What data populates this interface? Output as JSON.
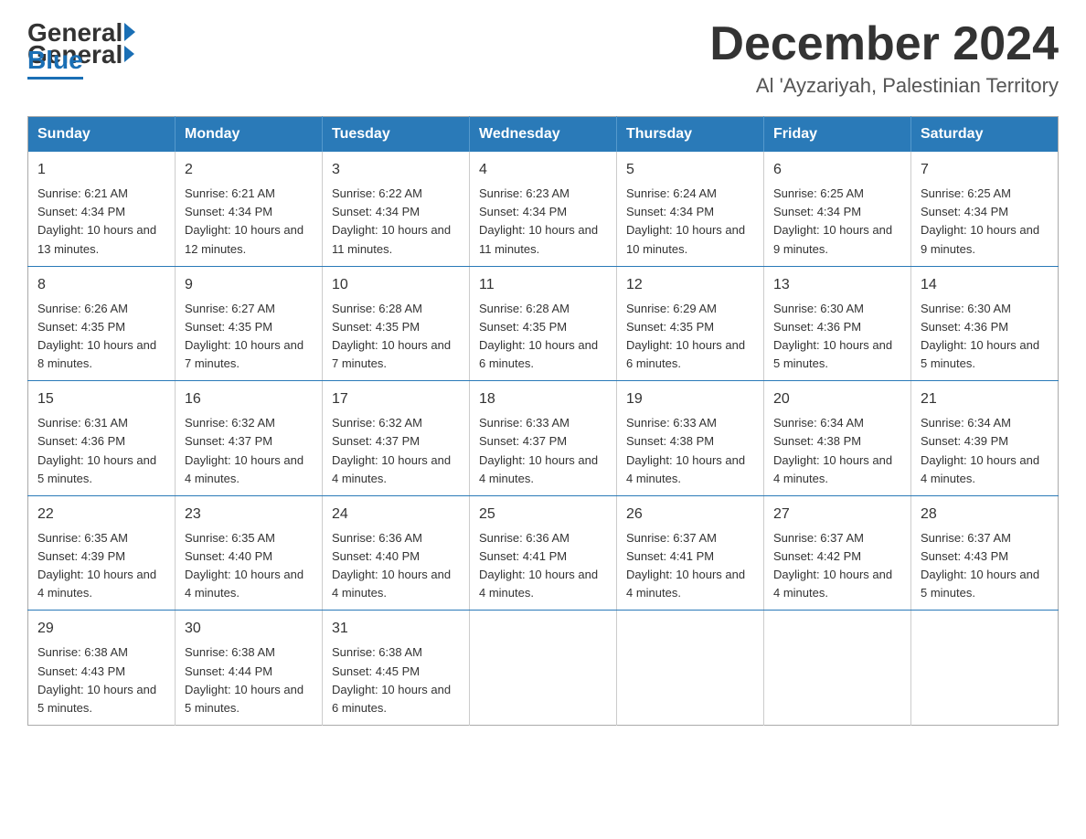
{
  "logo": {
    "general": "General",
    "blue": "Blue"
  },
  "title": "December 2024",
  "subtitle": "Al 'Ayzariyah, Palestinian Territory",
  "days_of_week": [
    "Sunday",
    "Monday",
    "Tuesday",
    "Wednesday",
    "Thursday",
    "Friday",
    "Saturday"
  ],
  "weeks": [
    [
      {
        "day": 1,
        "sunrise": "6:21 AM",
        "sunset": "4:34 PM",
        "daylight": "10 hours and 13 minutes."
      },
      {
        "day": 2,
        "sunrise": "6:21 AM",
        "sunset": "4:34 PM",
        "daylight": "10 hours and 12 minutes."
      },
      {
        "day": 3,
        "sunrise": "6:22 AM",
        "sunset": "4:34 PM",
        "daylight": "10 hours and 11 minutes."
      },
      {
        "day": 4,
        "sunrise": "6:23 AM",
        "sunset": "4:34 PM",
        "daylight": "10 hours and 11 minutes."
      },
      {
        "day": 5,
        "sunrise": "6:24 AM",
        "sunset": "4:34 PM",
        "daylight": "10 hours and 10 minutes."
      },
      {
        "day": 6,
        "sunrise": "6:25 AM",
        "sunset": "4:34 PM",
        "daylight": "10 hours and 9 minutes."
      },
      {
        "day": 7,
        "sunrise": "6:25 AM",
        "sunset": "4:34 PM",
        "daylight": "10 hours and 9 minutes."
      }
    ],
    [
      {
        "day": 8,
        "sunrise": "6:26 AM",
        "sunset": "4:35 PM",
        "daylight": "10 hours and 8 minutes."
      },
      {
        "day": 9,
        "sunrise": "6:27 AM",
        "sunset": "4:35 PM",
        "daylight": "10 hours and 7 minutes."
      },
      {
        "day": 10,
        "sunrise": "6:28 AM",
        "sunset": "4:35 PM",
        "daylight": "10 hours and 7 minutes."
      },
      {
        "day": 11,
        "sunrise": "6:28 AM",
        "sunset": "4:35 PM",
        "daylight": "10 hours and 6 minutes."
      },
      {
        "day": 12,
        "sunrise": "6:29 AM",
        "sunset": "4:35 PM",
        "daylight": "10 hours and 6 minutes."
      },
      {
        "day": 13,
        "sunrise": "6:30 AM",
        "sunset": "4:36 PM",
        "daylight": "10 hours and 5 minutes."
      },
      {
        "day": 14,
        "sunrise": "6:30 AM",
        "sunset": "4:36 PM",
        "daylight": "10 hours and 5 minutes."
      }
    ],
    [
      {
        "day": 15,
        "sunrise": "6:31 AM",
        "sunset": "4:36 PM",
        "daylight": "10 hours and 5 minutes."
      },
      {
        "day": 16,
        "sunrise": "6:32 AM",
        "sunset": "4:37 PM",
        "daylight": "10 hours and 4 minutes."
      },
      {
        "day": 17,
        "sunrise": "6:32 AM",
        "sunset": "4:37 PM",
        "daylight": "10 hours and 4 minutes."
      },
      {
        "day": 18,
        "sunrise": "6:33 AM",
        "sunset": "4:37 PM",
        "daylight": "10 hours and 4 minutes."
      },
      {
        "day": 19,
        "sunrise": "6:33 AM",
        "sunset": "4:38 PM",
        "daylight": "10 hours and 4 minutes."
      },
      {
        "day": 20,
        "sunrise": "6:34 AM",
        "sunset": "4:38 PM",
        "daylight": "10 hours and 4 minutes."
      },
      {
        "day": 21,
        "sunrise": "6:34 AM",
        "sunset": "4:39 PM",
        "daylight": "10 hours and 4 minutes."
      }
    ],
    [
      {
        "day": 22,
        "sunrise": "6:35 AM",
        "sunset": "4:39 PM",
        "daylight": "10 hours and 4 minutes."
      },
      {
        "day": 23,
        "sunrise": "6:35 AM",
        "sunset": "4:40 PM",
        "daylight": "10 hours and 4 minutes."
      },
      {
        "day": 24,
        "sunrise": "6:36 AM",
        "sunset": "4:40 PM",
        "daylight": "10 hours and 4 minutes."
      },
      {
        "day": 25,
        "sunrise": "6:36 AM",
        "sunset": "4:41 PM",
        "daylight": "10 hours and 4 minutes."
      },
      {
        "day": 26,
        "sunrise": "6:37 AM",
        "sunset": "4:41 PM",
        "daylight": "10 hours and 4 minutes."
      },
      {
        "day": 27,
        "sunrise": "6:37 AM",
        "sunset": "4:42 PM",
        "daylight": "10 hours and 4 minutes."
      },
      {
        "day": 28,
        "sunrise": "6:37 AM",
        "sunset": "4:43 PM",
        "daylight": "10 hours and 5 minutes."
      }
    ],
    [
      {
        "day": 29,
        "sunrise": "6:38 AM",
        "sunset": "4:43 PM",
        "daylight": "10 hours and 5 minutes."
      },
      {
        "day": 30,
        "sunrise": "6:38 AM",
        "sunset": "4:44 PM",
        "daylight": "10 hours and 5 minutes."
      },
      {
        "day": 31,
        "sunrise": "6:38 AM",
        "sunset": "4:45 PM",
        "daylight": "10 hours and 6 minutes."
      },
      null,
      null,
      null,
      null
    ]
  ]
}
